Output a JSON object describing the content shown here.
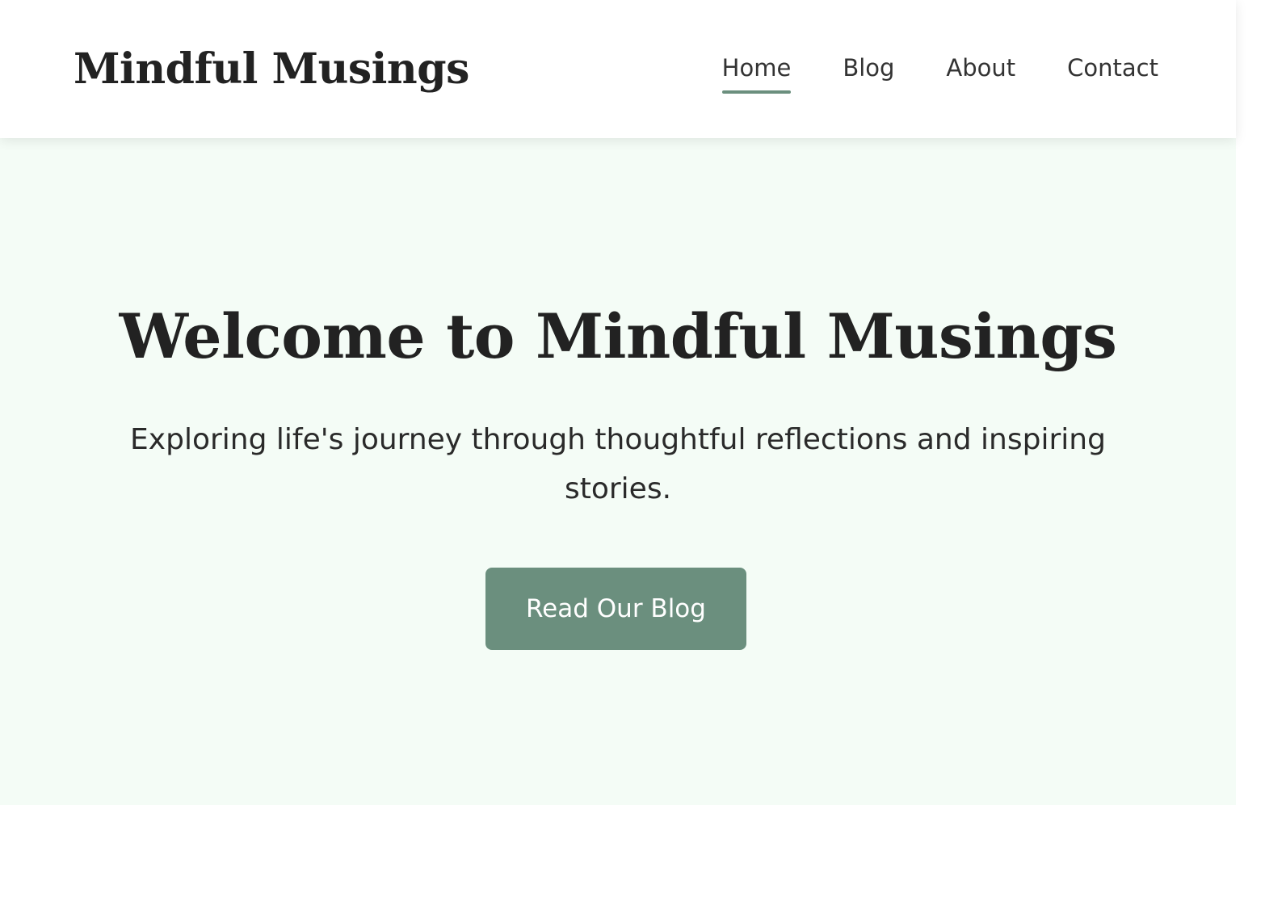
{
  "site": {
    "logo": "Mindful Musings"
  },
  "nav": {
    "items": [
      {
        "label": "Home",
        "active": true
      },
      {
        "label": "Blog",
        "active": false
      },
      {
        "label": "About",
        "active": false
      },
      {
        "label": "Contact",
        "active": false
      }
    ]
  },
  "hero": {
    "title": "Welcome to Mindful Musings",
    "subtitle": "Exploring life's journey through thoughtful reflections and inspiring stories.",
    "cta_label": "Read Our Blog"
  },
  "colors": {
    "accent": "#6b8f7e",
    "hero_background": "#f4fcf6",
    "text": "#222222"
  }
}
